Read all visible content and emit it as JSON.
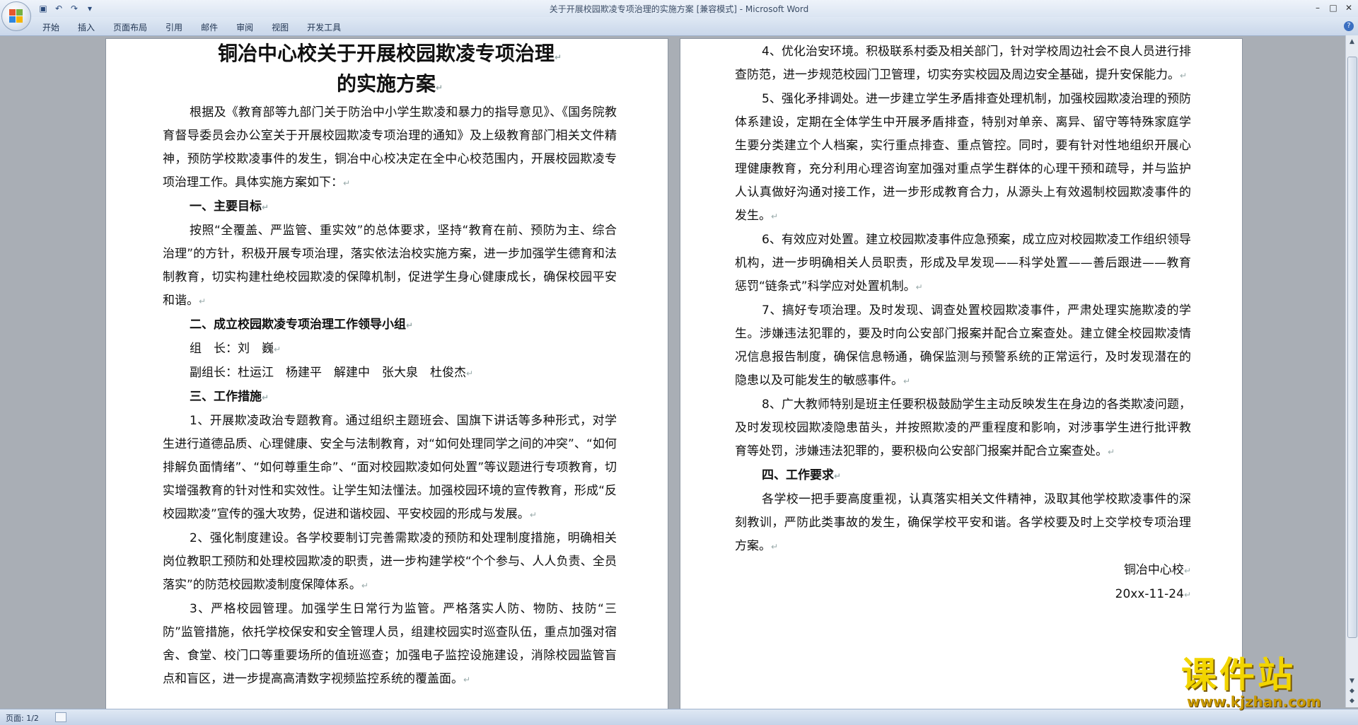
{
  "window": {
    "title": "关于开展校园欺凌专项治理的实施方案 [兼容模式] - Microsoft Word",
    "qat": [
      "save-icon",
      "undo-icon",
      "redo-icon",
      "customize-icon"
    ],
    "controls": [
      "minimize-icon",
      "maximize-icon",
      "close-icon"
    ]
  },
  "ribbon": {
    "tabs": [
      "开始",
      "插入",
      "页面布局",
      "引用",
      "邮件",
      "审阅",
      "视图",
      "开发工具"
    ]
  },
  "doc": {
    "title_line1": "铜冶中心校关于开展校园欺凌专项治理",
    "title_line2": "的实施方案",
    "intro": "根据及《教育部等九部门关于防治中小学生欺凌和暴力的指导意见》、《国务院教育督导委员会办公室关于开展校园欺凌专项治理的通知》及上级教育部门相关文件精神，预防学校欺凌事件的发生，铜冶中心校决定在全中心校范围内，开展校园欺凌专项治理工作。具体实施方案如下：",
    "h1": "一、主要目标",
    "p1": "按照“全覆盖、严监管、重实效”的总体要求，坚持“教育在前、预防为主、综合治理”的方针，积极开展专项治理，落实依法治校实施方案，进一步加强学生德育和法制教育，切实构建杜绝校园欺凌的保障机制，促进学生身心健康成长，确保校园平安和谐。",
    "h2": "二、成立校园欺凌专项治理工作领导小组",
    "leader": "组　长：刘　巍",
    "deputy": "副组长：杜运江　杨建平　解建中　张大泉　杜俊杰",
    "h3": "三、工作措施",
    "m1": "1、开展欺凌政治专题教育。通过组织主题班会、国旗下讲话等多种形式，对学生进行道德品质、心理健康、安全与法制教育，对“如何处理同学之间的冲突”、“如何排解负面情绪”、“如何尊重生命”、“面对校园欺凌如何处置”等议题进行专项教育，切实增强教育的针对性和实效性。让学生知法懂法。加强校园环境的宣传教育，形成“反校园欺凌”宣传的强大攻势，促进和谐校园、平安校园的形成与发展。",
    "m2": "2、强化制度建设。各学校要制订完善需欺凌的预防和处理制度措施，明确相关岗位教职工预防和处理校园欺凌的职责，进一步构建学校“个个参与、人人负责、全员落实”的防范校园欺凌制度保障体系。",
    "m3": "3、严格校园管理。加强学生日常行为监管。严格落实人防、物防、技防“三防”监管措施，依托学校保安和安全管理人员，组建校园实时巡查队伍，重点加强对宿舍、食堂、校门口等重要场所的值班巡查；加强电子监控设施建设，消除校园监管盲点和盲区，进一步提高高清数字视频监控系统的覆盖面。",
    "m4": "4、优化治安环境。积极联系村委及相关部门，针对学校周边社会不良人员进行排查防范，进一步规范校园门卫管理，切实夯实校园及周边安全基础，提升安保能力。",
    "m5": "5、强化矛排调处。进一步建立学生矛盾排查处理机制，加强校园欺凌治理的预防体系建设，定期在全体学生中开展矛盾排查，特别对单亲、离异、留守等特殊家庭学生要分类建立个人档案，实行重点排查、重点管控。同时，要有针对性地组织开展心理健康教育，充分利用心理咨询室加强对重点学生群体的心理干预和疏导，并与监护人认真做好沟通对接工作，进一步形成教育合力，从源头上有效遏制校园欺凌事件的发生。",
    "m6": "6、有效应对处置。建立校园欺凌事件应急预案，成立应对校园欺凌工作组织领导机构，进一步明确相关人员职责，形成及早发现——科学处置——善后跟进——教育惩罚“链条式”科学应对处置机制。",
    "m7": "7、搞好专项治理。及时发现、调查处置校园欺凌事件，严肃处理实施欺凌的学生。涉嫌违法犯罪的，要及时向公安部门报案并配合立案查处。建立健全校园欺凌情况信息报告制度，确保信息畅通，确保监测与预警系统的正常运行，及时发现潜在的隐患以及可能发生的敏感事件。",
    "m8": "8、广大教师特别是班主任要积极鼓励学生主动反映发生在身边的各类欺凌问题，及时发现校园欺凌隐患苗头，并按照欺凌的严重程度和影响，对涉事学生进行批评教育等处罚，涉嫌违法犯罪的，要积极向公安部门报案并配合立案查处。",
    "h4": "四、工作要求",
    "req": "各学校一把手要高度重视，认真落实相关文件精神，汲取其他学校欺凌事件的深刻教训，严防此类事故的发生，确保学校平安和谐。各学校要及时上交学校专项治理方案。",
    "sign_org": "铜冶中心校",
    "sign_date": "20xx-11-24"
  },
  "status": {
    "page": "页面: 1/2"
  },
  "watermark": {
    "cn": "课件站",
    "url": "www.kjzhan.com"
  }
}
